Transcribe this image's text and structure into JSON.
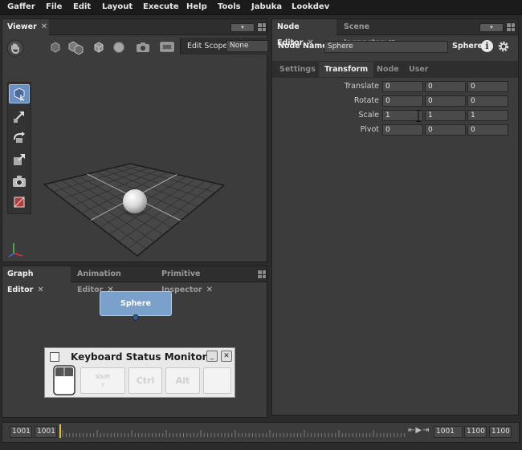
{
  "menu": [
    "Gaffer",
    "File",
    "Edit",
    "Layout",
    "Execute",
    "Help",
    "Tools",
    "Jabuka",
    "Lookdev"
  ],
  "viewer": {
    "tab_label": "Viewer",
    "close_glyph": "✕",
    "edit_scope_label": "Edit Scope",
    "edit_scope_value": "None"
  },
  "node_editor": {
    "tabs": [
      "Node Editor",
      "Scene Inspector"
    ],
    "close_glyph": "✕",
    "node_name_label": "Node Name",
    "node_name_value": "Sphere",
    "node_type": "Sphere",
    "subtabs": [
      "Settings",
      "Transform",
      "Node",
      "User"
    ],
    "params": [
      {
        "label": "Translate",
        "values": [
          "0",
          "0",
          "0"
        ]
      },
      {
        "label": "Rotate",
        "values": [
          "0",
          "0",
          "0"
        ]
      },
      {
        "label": "Scale",
        "values": [
          "1",
          "1",
          "1"
        ]
      },
      {
        "label": "Pivot",
        "values": [
          "0",
          "0",
          "0"
        ]
      }
    ]
  },
  "graph_editor": {
    "tabs": [
      "Graph Editor",
      "Animation Editor",
      "Primitive Inspector"
    ],
    "close_glyph": "✕",
    "node_label": "Sphere"
  },
  "keyboard_monitor": {
    "title": "Keyboard Status Monitor",
    "minimize_glyph": "_",
    "close_glyph": "✕",
    "keys": [
      "Shift",
      "Ctrl",
      "Alt",
      ""
    ]
  },
  "timeline": {
    "start": "1001",
    "current": "1001",
    "right_current": "1001",
    "end": "1100",
    "right_end": "1100"
  },
  "colors": {
    "accent": "#7aa0cc",
    "panel": "#3c3c3c",
    "playhead": "#e8c23a"
  }
}
